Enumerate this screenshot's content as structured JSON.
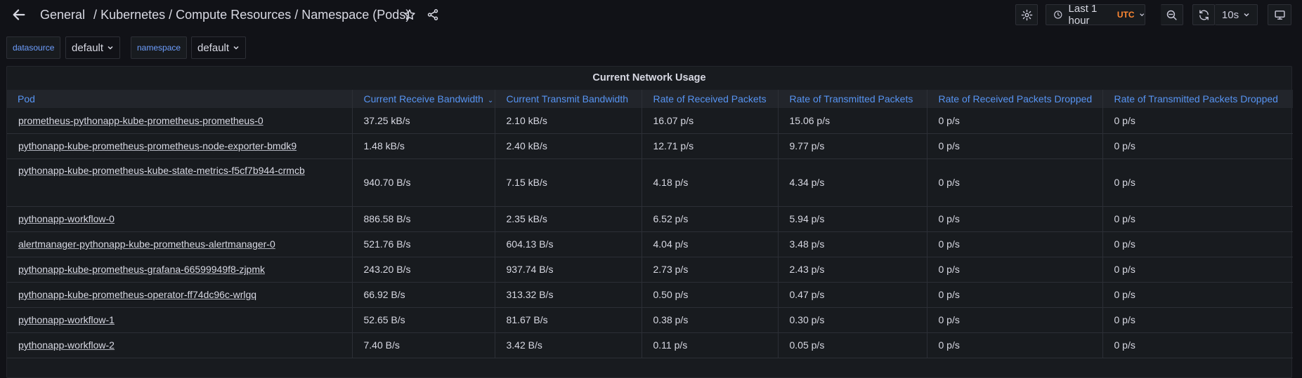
{
  "breadcrumb": {
    "items": [
      "General",
      "Kubernetes",
      "Compute Resources",
      "Namespace (Pods)"
    ],
    "separator": "/"
  },
  "toolbar": {
    "time_range": "Last 1 hour",
    "timezone": "UTC",
    "refresh_interval": "10s"
  },
  "variables": [
    {
      "label": "datasource",
      "value": "default"
    },
    {
      "label": "namespace",
      "value": "default"
    }
  ],
  "panel": {
    "title": "Current Network Usage",
    "columns": [
      "Pod",
      "Current Receive Bandwidth",
      "Current Transmit Bandwidth",
      "Rate of Received Packets",
      "Rate of Transmitted Packets",
      "Rate of Received Packets Dropped",
      "Rate of Transmitted Packets Dropped"
    ],
    "sorted_column": "Current Receive Bandwidth",
    "rows": [
      [
        "prometheus-pythonapp-kube-prometheus-prometheus-0",
        "37.25 kB/s",
        "2.10 kB/s",
        "16.07 p/s",
        "15.06 p/s",
        "0 p/s",
        "0 p/s"
      ],
      [
        "pythonapp-kube-prometheus-prometheus-node-exporter-bmdk9",
        "1.48 kB/s",
        "2.40 kB/s",
        "12.71 p/s",
        "9.77 p/s",
        "0 p/s",
        "0 p/s"
      ],
      [
        "pythonapp-kube-prometheus-kube-state-metrics-f5cf7b944-crmcb",
        "940.70 B/s",
        "7.15 kB/s",
        "4.18 p/s",
        "4.34 p/s",
        "0 p/s",
        "0 p/s"
      ],
      [
        "pythonapp-workflow-0",
        "886.58 B/s",
        "2.35 kB/s",
        "6.52 p/s",
        "5.94 p/s",
        "0 p/s",
        "0 p/s"
      ],
      [
        "alertmanager-pythonapp-kube-prometheus-alertmanager-0",
        "521.76 B/s",
        "604.13 B/s",
        "4.04 p/s",
        "3.48 p/s",
        "0 p/s",
        "0 p/s"
      ],
      [
        "pythonapp-kube-prometheus-grafana-66599949f8-zjpmk",
        "243.20 B/s",
        "937.74 B/s",
        "2.73 p/s",
        "2.43 p/s",
        "0 p/s",
        "0 p/s"
      ],
      [
        "pythonapp-kube-prometheus-operator-ff74dc96c-wrlgq",
        "66.92 B/s",
        "313.32 B/s",
        "0.50 p/s",
        "0.47 p/s",
        "0 p/s",
        "0 p/s"
      ],
      [
        "pythonapp-workflow-1",
        "52.65 B/s",
        "81.67 B/s",
        "0.38 p/s",
        "0.30 p/s",
        "0 p/s",
        "0 p/s"
      ],
      [
        "pythonapp-workflow-2",
        "7.40 B/s",
        "3.42 B/s",
        "0.11 p/s",
        "0.05 p/s",
        "0 p/s",
        "0 p/s"
      ]
    ]
  },
  "icons": {
    "back": "arrow-left-icon",
    "star": "star-icon",
    "share": "share-icon",
    "settings": "gear-icon",
    "clock": "clock-icon",
    "zoom_out": "zoom-out-icon",
    "refresh": "refresh-icon",
    "tv": "monitor-icon"
  },
  "colors": {
    "background": "#111217",
    "panel": "#181b1f",
    "header_link": "#5794f2",
    "utc_badge": "#ff8833"
  }
}
